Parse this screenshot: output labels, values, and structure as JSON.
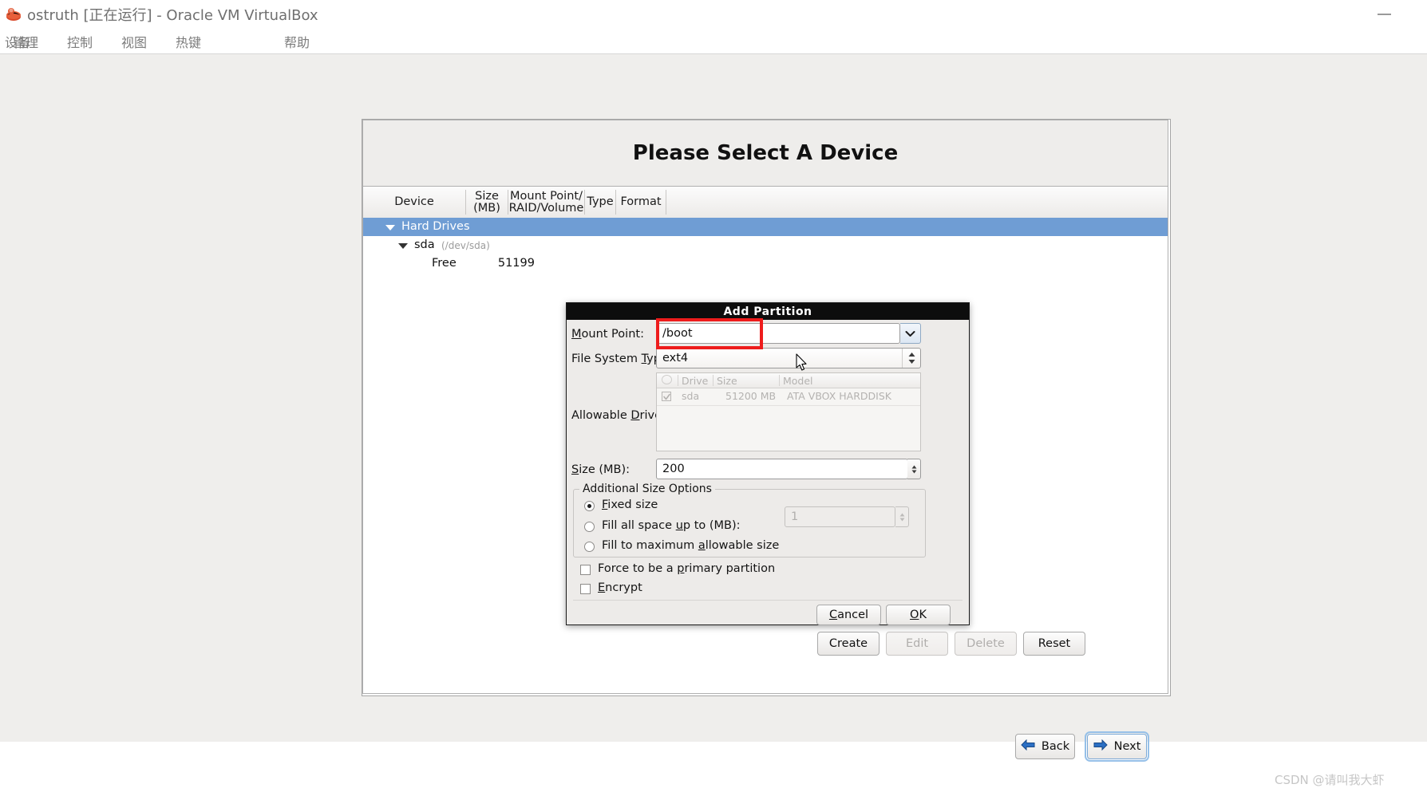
{
  "vbox": {
    "title": "ostruth [正在运行] - Oracle VM VirtualBox",
    "icon": "virtualbox-icon",
    "minimize_label": "—",
    "menu": [
      "管理",
      "控制",
      "视图",
      "热键",
      "设备",
      "帮助"
    ]
  },
  "wizard": {
    "header_title": "Please Select A Device",
    "table": {
      "columns": [
        "Device",
        "Size\n(MB)",
        "Mount Point/\nRAID/Volume",
        "Type",
        "Format"
      ],
      "col_device": "Device",
      "col_size_l1": "Size",
      "col_size_l2": "(MB)",
      "col_mount_l1": "Mount Point/",
      "col_mount_l2": "RAID/Volume",
      "col_type": "Type",
      "col_format": "Format",
      "rows": [
        {
          "label": "Hard Drives",
          "size": "",
          "selected": true,
          "expanded": true
        },
        {
          "label": "sda",
          "device_path": "(/dev/sda)",
          "size": "",
          "expanded": true
        },
        {
          "label": "Free",
          "size": "51199"
        }
      ]
    },
    "buttons": {
      "create": "Create",
      "edit": "Edit",
      "delete": "Delete",
      "reset": "Reset",
      "back": "Back",
      "next": "Next"
    }
  },
  "dialog": {
    "title": "Add Partition",
    "mount_point": {
      "label": "Mount Point:",
      "value": "/boot",
      "placeholder": ""
    },
    "file_system_type": {
      "label": "File System Type:",
      "value": "ext4"
    },
    "allowable_drives": {
      "label": "Allowable Drives:",
      "columns": [
        "",
        "Drive",
        "Size",
        "Model"
      ],
      "col_drive": "Drive",
      "col_size": "Size",
      "col_model": "Model",
      "rows": [
        {
          "checked": true,
          "drive": "sda",
          "size": "51200 MB",
          "model": "ATA VBOX HARDDISK"
        }
      ]
    },
    "size": {
      "label": "Size (MB):",
      "value": "200"
    },
    "additional_size_options": {
      "legend": "Additional Size Options",
      "options": [
        {
          "label": "Fixed size",
          "selected": true
        },
        {
          "label": "Fill all space up to (MB):",
          "selected": false,
          "value": "1"
        },
        {
          "label": "Fill to maximum allowable size",
          "selected": false
        }
      ]
    },
    "checkboxes": [
      {
        "label": "Force to be a primary partition",
        "checked": false
      },
      {
        "label": "Encrypt",
        "checked": false
      }
    ],
    "buttons": {
      "cancel": "Cancel",
      "ok": "OK"
    }
  },
  "annotation": {
    "highlight_color": "#ee1c1c"
  },
  "watermark": "CSDN @请叫我大虾"
}
